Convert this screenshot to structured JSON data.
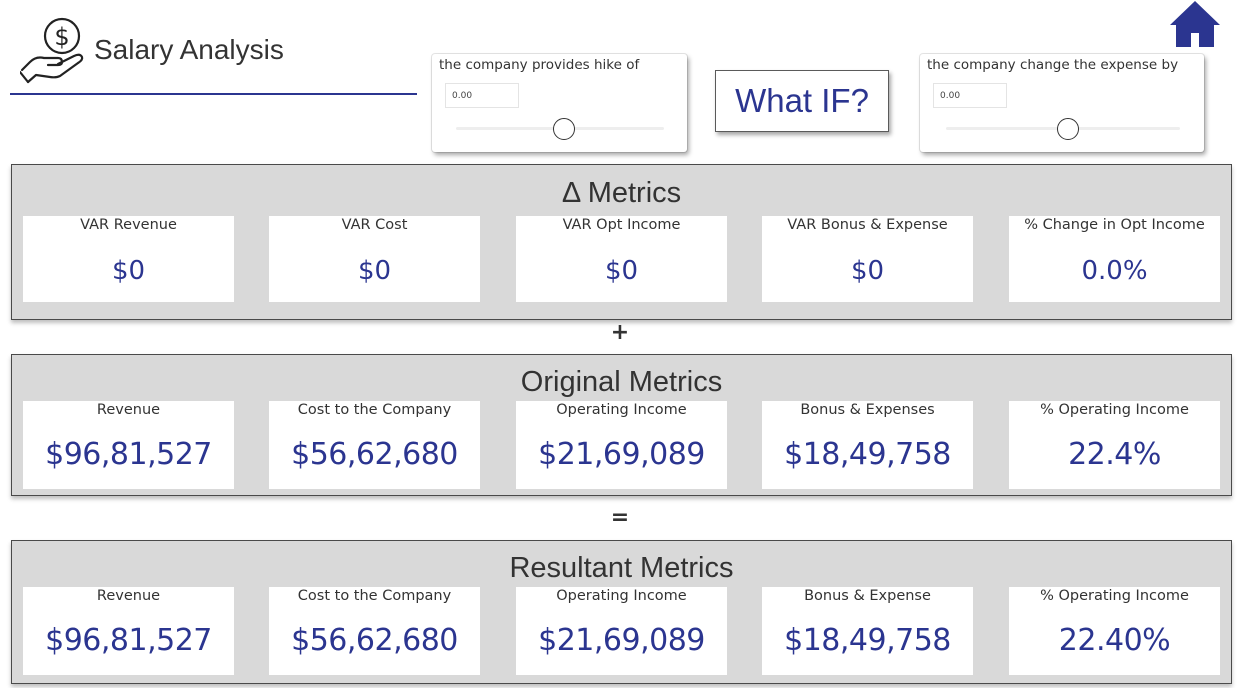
{
  "header": {
    "title": "Salary Analysis",
    "icon": "salary-hand-icon",
    "home_icon": "home-icon",
    "accent_color": "#2b3590"
  },
  "controls": {
    "hike": {
      "label": "the company provides hike of",
      "value": "0.00"
    },
    "expense": {
      "label": "the company change the expense by",
      "value": "0.00"
    },
    "what_if_label": "What IF?"
  },
  "sections": [
    {
      "title": "Δ Metrics",
      "cards": [
        {
          "label": "VAR Revenue",
          "value": "$0"
        },
        {
          "label": "VAR Cost",
          "value": "$0"
        },
        {
          "label": "VAR Opt Income",
          "value": "$0"
        },
        {
          "label": "VAR Bonus & Expense",
          "value": "$0"
        },
        {
          "label": "% Change in Opt Income",
          "value": "0.0%"
        }
      ]
    },
    {
      "title": "Original Metrics",
      "cards": [
        {
          "label": "Revenue",
          "value": "$96,81,527"
        },
        {
          "label": "Cost to the Company",
          "value": "$56,62,680"
        },
        {
          "label": "Operating Income",
          "value": "$21,69,089"
        },
        {
          "label": "Bonus & Expenses",
          "value": "$18,49,758"
        },
        {
          "label": "% Operating Income",
          "value": "22.4%"
        }
      ]
    },
    {
      "title": "Resultant Metrics",
      "cards": [
        {
          "label": "Revenue",
          "value": "$96,81,527"
        },
        {
          "label": "Cost to the Company",
          "value": "$56,62,680"
        },
        {
          "label": "Operating Income",
          "value": "$21,69,089"
        },
        {
          "label": "Bonus & Expense",
          "value": "$18,49,758"
        },
        {
          "label": "% Operating Income",
          "value": "22.40%"
        }
      ]
    }
  ],
  "operators": {
    "plus": "+",
    "equals": "="
  }
}
